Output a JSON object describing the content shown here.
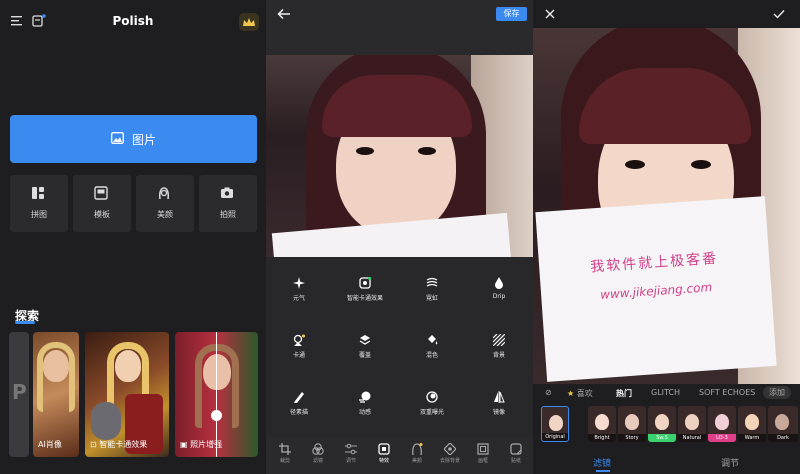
{
  "left_screen": {
    "title": "Polish",
    "header_icons": [
      "menu-icon",
      "layers-icon",
      "crown-icon"
    ],
    "main_button": {
      "label": "图片",
      "icon": "image-icon"
    },
    "tools": [
      {
        "label": "拼图",
        "icon": "collage-icon"
      },
      {
        "label": "模板",
        "icon": "template-icon"
      },
      {
        "label": "美颜",
        "icon": "face-icon"
      },
      {
        "label": "拍照",
        "icon": "camera-icon"
      }
    ],
    "explore_title": "探索",
    "cards": [
      {
        "label": "P"
      },
      {
        "label": "AI肖像"
      },
      {
        "label": "智能卡通效果"
      },
      {
        "label": "照片增强"
      }
    ],
    "accent": "#3a8af0"
  },
  "middle_screen": {
    "save_label": "保存",
    "tools": [
      {
        "label": "元气",
        "icon": "sparkle-icon"
      },
      {
        "label": "智能卡通效果",
        "icon": "cartoon-icon"
      },
      {
        "label": "霓虹",
        "icon": "neon-icon"
      },
      {
        "label": "Drip",
        "icon": "drip-icon"
      },
      {
        "label": "卡通",
        "icon": "cartoon-face-icon"
      },
      {
        "label": "覆盖",
        "icon": "overlay-icon"
      },
      {
        "label": "混色",
        "icon": "paint-bucket-icon"
      },
      {
        "label": "背景",
        "icon": "background-icon"
      },
      {
        "label": "径素描",
        "icon": "sketch-icon"
      },
      {
        "label": "动感",
        "icon": "motion-icon"
      },
      {
        "label": "双重曝光",
        "icon": "exposure-icon"
      },
      {
        "label": "镜像",
        "icon": "mirror-icon"
      }
    ],
    "bottom_nav": [
      {
        "label": "裁剪",
        "icon": "crop-icon"
      },
      {
        "label": "滤镜",
        "icon": "filter-icon"
      },
      {
        "label": "调节",
        "icon": "adjust-icon"
      },
      {
        "label": "特效",
        "icon": "effects-icon"
      },
      {
        "label": "美颜",
        "icon": "beauty-icon"
      },
      {
        "label": "去除背景",
        "icon": "remove-bg-icon"
      },
      {
        "label": "画框",
        "icon": "frame-icon"
      },
      {
        "label": "贴纸",
        "icon": "sticker-icon"
      }
    ]
  },
  "right_screen": {
    "photo_text": {
      "line1": "我软件就上极客番",
      "line2": "www.jikejiang.com"
    },
    "categories": [
      "喜欢",
      "热门",
      "GLITCH",
      "SOFT ECHOES",
      "添加"
    ],
    "filters": [
      {
        "label": "Original"
      },
      {
        "label": "Bright"
      },
      {
        "label": "Story"
      },
      {
        "label": "Sw.S"
      },
      {
        "label": "Natural"
      },
      {
        "label": "LO-3"
      },
      {
        "label": "Warm"
      },
      {
        "label": "Dark"
      }
    ],
    "tabs": [
      "滤镜",
      "调节"
    ],
    "active_tab": "滤镜",
    "active_category": "热门"
  }
}
